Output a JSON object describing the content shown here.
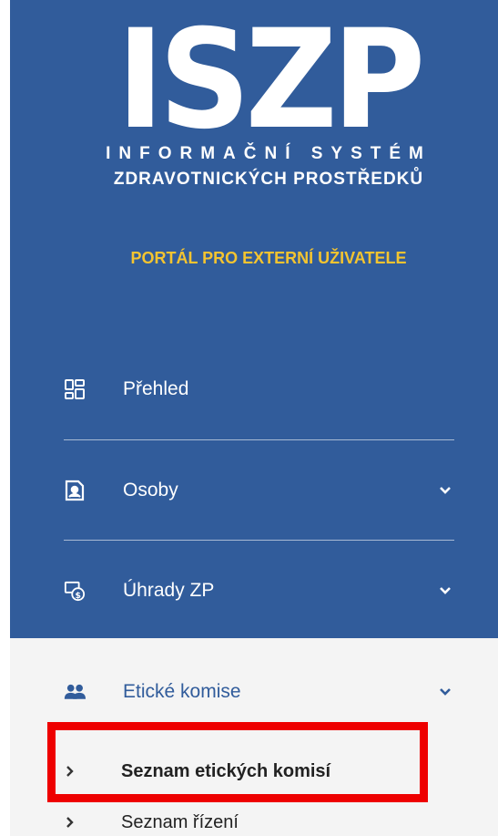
{
  "logo": {
    "title": "ISZP",
    "line1": "INFORMAČNÍ SYSTÉM",
    "line2": "ZDRAVOTNICKÝCH PROSTŘEDKŮ"
  },
  "portal_label": "PORTÁL PRO EXTERNÍ UŽIVATELE",
  "menu": {
    "items": [
      {
        "label": "Přehled",
        "icon": "dashboard-icon"
      },
      {
        "label": "Osoby",
        "icon": "person-badge-icon",
        "expandable": true
      },
      {
        "label": "Úhrady ZP",
        "icon": "payments-icon",
        "expandable": true
      },
      {
        "label": "Etické komise",
        "icon": "people-icon",
        "expandable": true,
        "expanded": true
      }
    ],
    "submenu": [
      {
        "label": "Seznam etických komisí",
        "active": true
      },
      {
        "label": "Seznam řízení"
      }
    ]
  },
  "colors": {
    "sidebar_blue": "#315c9b",
    "portal_yellow": "#f4c430",
    "highlight_red": "#ee0000",
    "expanded_bg": "#f4f4f4"
  }
}
